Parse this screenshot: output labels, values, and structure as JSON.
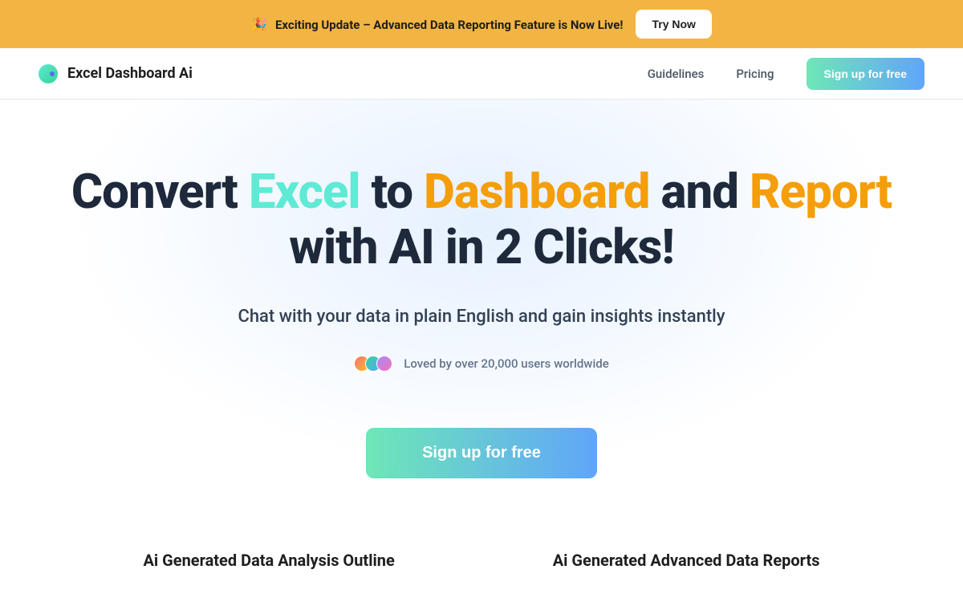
{
  "announcement": {
    "icon": "🎉",
    "text": "Exciting Update – Advanced Data Reporting Feature is Now Live!",
    "button_label": "Try Now"
  },
  "nav": {
    "brand_name": "Excel Dashboard Ai",
    "links": {
      "guidelines": "Guidelines",
      "pricing": "Pricing"
    },
    "signup_label": "Sign up for free"
  },
  "hero": {
    "title_parts": {
      "p1": "Convert ",
      "p2": "Excel",
      "p3": " to ",
      "p4": "Dashboard",
      "p5": " and ",
      "p6": "Report",
      "p7": "with AI in 2 Clicks!"
    },
    "subtitle": "Chat with your data in plain English and gain insights instantly",
    "social_proof": "Loved by over 20,000 users worldwide",
    "cta_label": "Sign up for free"
  },
  "features": {
    "left": "Ai Generated Data Analysis Outline",
    "right": "Ai Generated Advanced Data Reports"
  }
}
